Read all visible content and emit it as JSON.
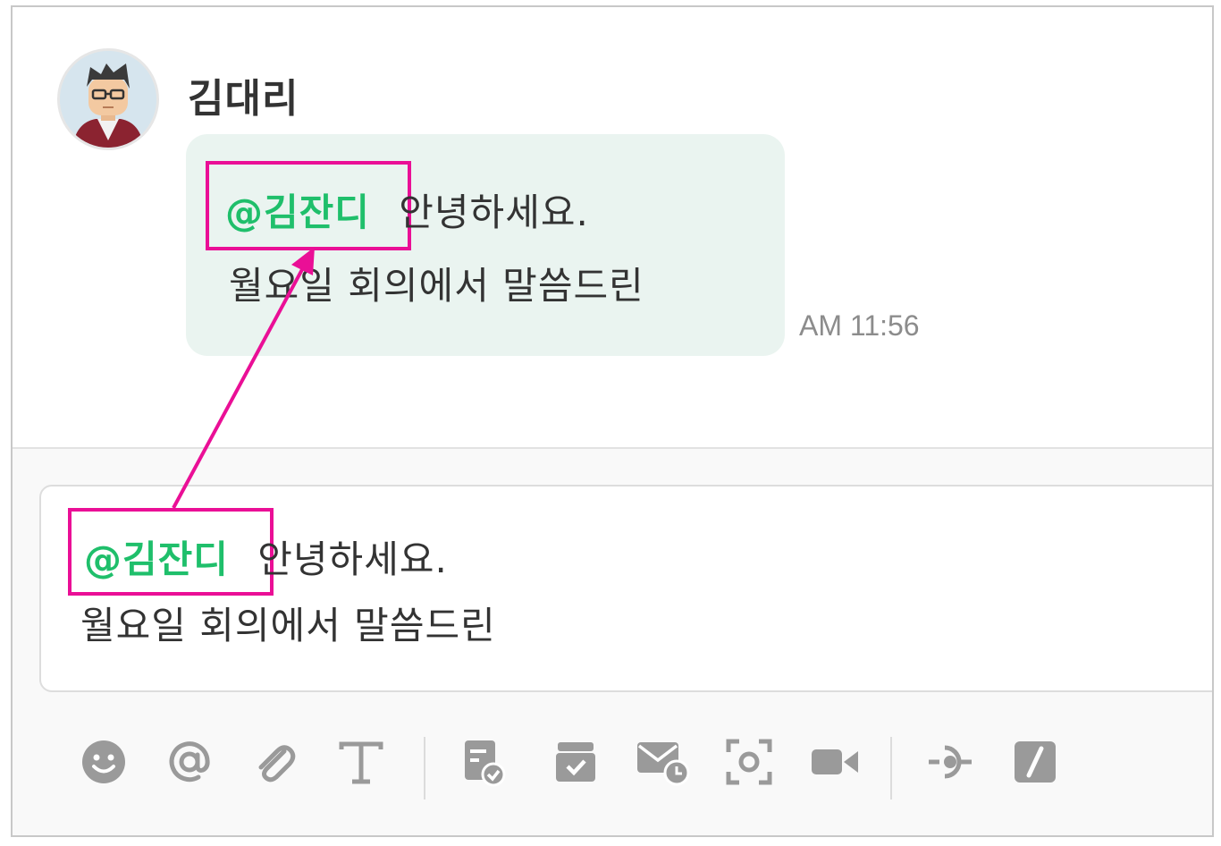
{
  "message": {
    "sender": "김대리",
    "mention": "@김잔디",
    "line1_rest": "안녕하세요.",
    "line2": "월요일 회의에서 말씀드린",
    "time": "AM 11:56"
  },
  "composer": {
    "mention": "@김잔디",
    "line1_rest": "안녕하세요.",
    "line2": "월요일 회의에서 말씀드린"
  },
  "toolbar": {
    "icons": [
      "emoji-icon",
      "mention-icon",
      "attach-icon",
      "text-format-icon",
      "todo-icon",
      "archive-icon",
      "schedule-mail-icon",
      "screen-capture-icon",
      "video-icon",
      "integration-icon",
      "slash-command-icon"
    ]
  },
  "colors": {
    "mention_green": "#1fbf6b",
    "highlight_pink": "#ea0f96",
    "bubble_bg": "#eaf4f0",
    "icon_gray": "#9a9a9a"
  }
}
